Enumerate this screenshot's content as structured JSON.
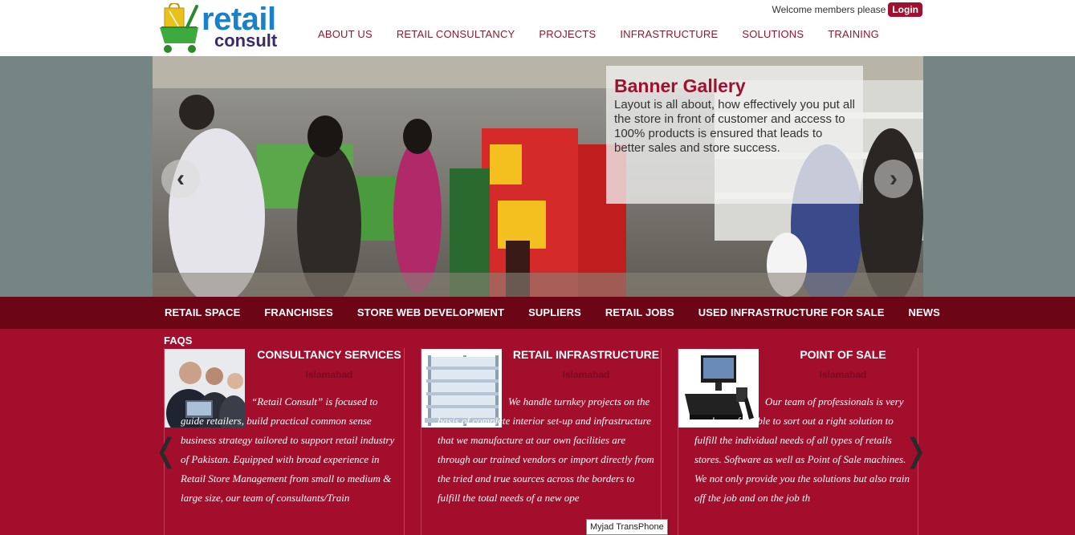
{
  "header": {
    "logo_line1": "retail",
    "logo_line2": "consult",
    "welcome_text": "Welcome members please",
    "login_label": "Login"
  },
  "top_nav": [
    {
      "label": "ABOUT US"
    },
    {
      "label": "RETAIL CONSULTANCY"
    },
    {
      "label": "PROJECTS"
    },
    {
      "label": "INFRASTRUCTURE"
    },
    {
      "label": "SOLUTIONS"
    },
    {
      "label": "TRAINING"
    }
  ],
  "banner": {
    "title": "Banner Gallery",
    "text": "Layout is all about, how effectively you put all the store in front of customer and access to 100% products is ensured that leads to better sales and store success.",
    "prev_icon": "‹",
    "next_icon": "›"
  },
  "sub_nav": [
    {
      "label": "RETAIL SPACE"
    },
    {
      "label": "FRANCHISES"
    },
    {
      "label": "STORE WEB DEVELOPMENT"
    },
    {
      "label": "SUPLIERS"
    },
    {
      "label": "RETAIL JOBS"
    },
    {
      "label": "USED INFRASTRUCTURE FOR SALE"
    },
    {
      "label": "NEWS"
    }
  ],
  "faqs_label": "FAQS",
  "cards": [
    {
      "title": "CONSULTANCY SERVICES",
      "location": "Islamabad",
      "text": "“Retail Consult” is focused to guide retailers, build practical common sense business strategy tailored to support retail industry of Pakistan. Equipped with broad experience in Retail Store Management from small to medium & large size, our team of consultants/Train"
    },
    {
      "title": "RETAIL INFRASTRUCTURE",
      "location": "Islamabad",
      "text": "We handle turnkey projects on the basis of complete interior set-up and infrastructure that we manufacture at our own facilities are through our trained vendors or import directly from the tried and true sources across the borders to fulfill the total needs of a new ope"
    },
    {
      "title": "POINT OF SALE",
      "location": "Islamabad",
      "text": "Our team of professionals is very much comfortable to sort out a right solution to fulfill the individual needs of all types of retails stores. Software as well as Point of Sale machines. We not only provide you the solutions but also train off the job and on the job th"
    }
  ],
  "carousel": {
    "prev_icon": "❬",
    "next_icon": "❭"
  },
  "tooltip": "Myjad TransPhone",
  "colors": {
    "brand_red": "#a30e2d",
    "nav_dark": "#6c0515",
    "logo_blue": "#1a80c8",
    "logo_green": "#3caa3c"
  }
}
